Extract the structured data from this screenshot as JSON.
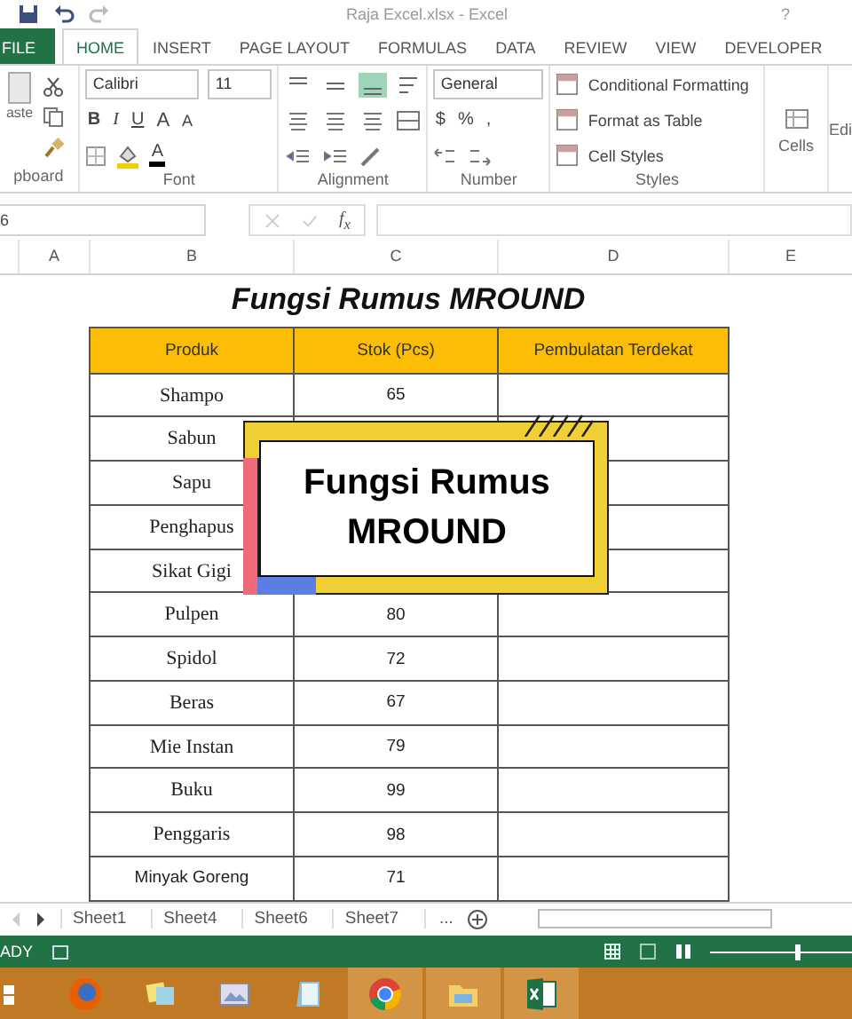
{
  "window": {
    "title": "Raja Excel.xlsx - Excel",
    "help": "?"
  },
  "ribbon_tabs": [
    {
      "label": "FILE",
      "kind": "file",
      "selected": false
    },
    {
      "label": "HOME",
      "kind": "tab",
      "selected": true
    },
    {
      "label": "INSERT",
      "kind": "tab",
      "selected": false
    },
    {
      "label": "PAGE LAYOUT",
      "kind": "tab",
      "selected": false
    },
    {
      "label": "FORMULAS",
      "kind": "tab",
      "selected": false
    },
    {
      "label": "DATA",
      "kind": "tab",
      "selected": false
    },
    {
      "label": "REVIEW",
      "kind": "tab",
      "selected": false
    },
    {
      "label": "VIEW",
      "kind": "tab",
      "selected": false
    },
    {
      "label": "DEVELOPER",
      "kind": "tab",
      "selected": false
    }
  ],
  "ribbon": {
    "clipboard": {
      "paste": "aste",
      "label": "pboard"
    },
    "font": {
      "name": "Calibri",
      "size": "11",
      "bold": "B",
      "italic": "I",
      "underline": "U",
      "grow": "A",
      "shrink": "A",
      "font_color": "A",
      "label": "Font"
    },
    "alignment": {
      "label": "Alignment"
    },
    "number": {
      "format": "General",
      "currency": "$",
      "percent": "%",
      "comma": ",",
      "label": "Number"
    },
    "styles": {
      "items": [
        "Conditional Formatting",
        "Format as Table",
        "Cell Styles"
      ],
      "label": "Styles"
    },
    "cells": {
      "label": "Cells"
    },
    "editing": {
      "label": "Edi"
    }
  },
  "formula_bar": {
    "name_box": "6",
    "fx": "f$_{x}$"
  },
  "columns": [
    "A",
    "B",
    "C",
    "D",
    "E"
  ],
  "sheet": {
    "title": "Fungsi Rumus MROUND",
    "headers": [
      "Produk",
      "Stok (Pcs)",
      "Pembulatan Terdekat"
    ],
    "rows": [
      {
        "product": "Shampo",
        "stock": "65"
      },
      {
        "product": "Sabun"
      },
      {
        "product": "Sapu"
      },
      {
        "product": "Penghapus"
      },
      {
        "product": "Sikat Gigi"
      },
      {
        "product": "Pulpen",
        "stock": "80"
      },
      {
        "product": "Spidol",
        "stock": "72"
      },
      {
        "product": "Beras",
        "stock": "67"
      },
      {
        "product": "Mie Instan",
        "stock": "79"
      },
      {
        "product": "Buku",
        "stock": "99"
      },
      {
        "product": "Penggaris",
        "stock": "98"
      },
      {
        "product": "Minyak Goreng",
        "stock": "71",
        "kind": "sans"
      }
    ]
  },
  "overlay": {
    "title": "Fungsi Rumus MROUND"
  },
  "sheet_tabs": [
    {
      "label": "Sheet1",
      "selected": false
    },
    {
      "label": "Sheet4",
      "selected": false
    },
    {
      "label": "Sheet6",
      "selected": false
    },
    {
      "label": "Sheet7",
      "selected": false
    }
  ],
  "more_sheets": "...",
  "status_bar": {
    "mode": "ADY",
    "zoom": {
      "level": 0.6
    }
  }
}
